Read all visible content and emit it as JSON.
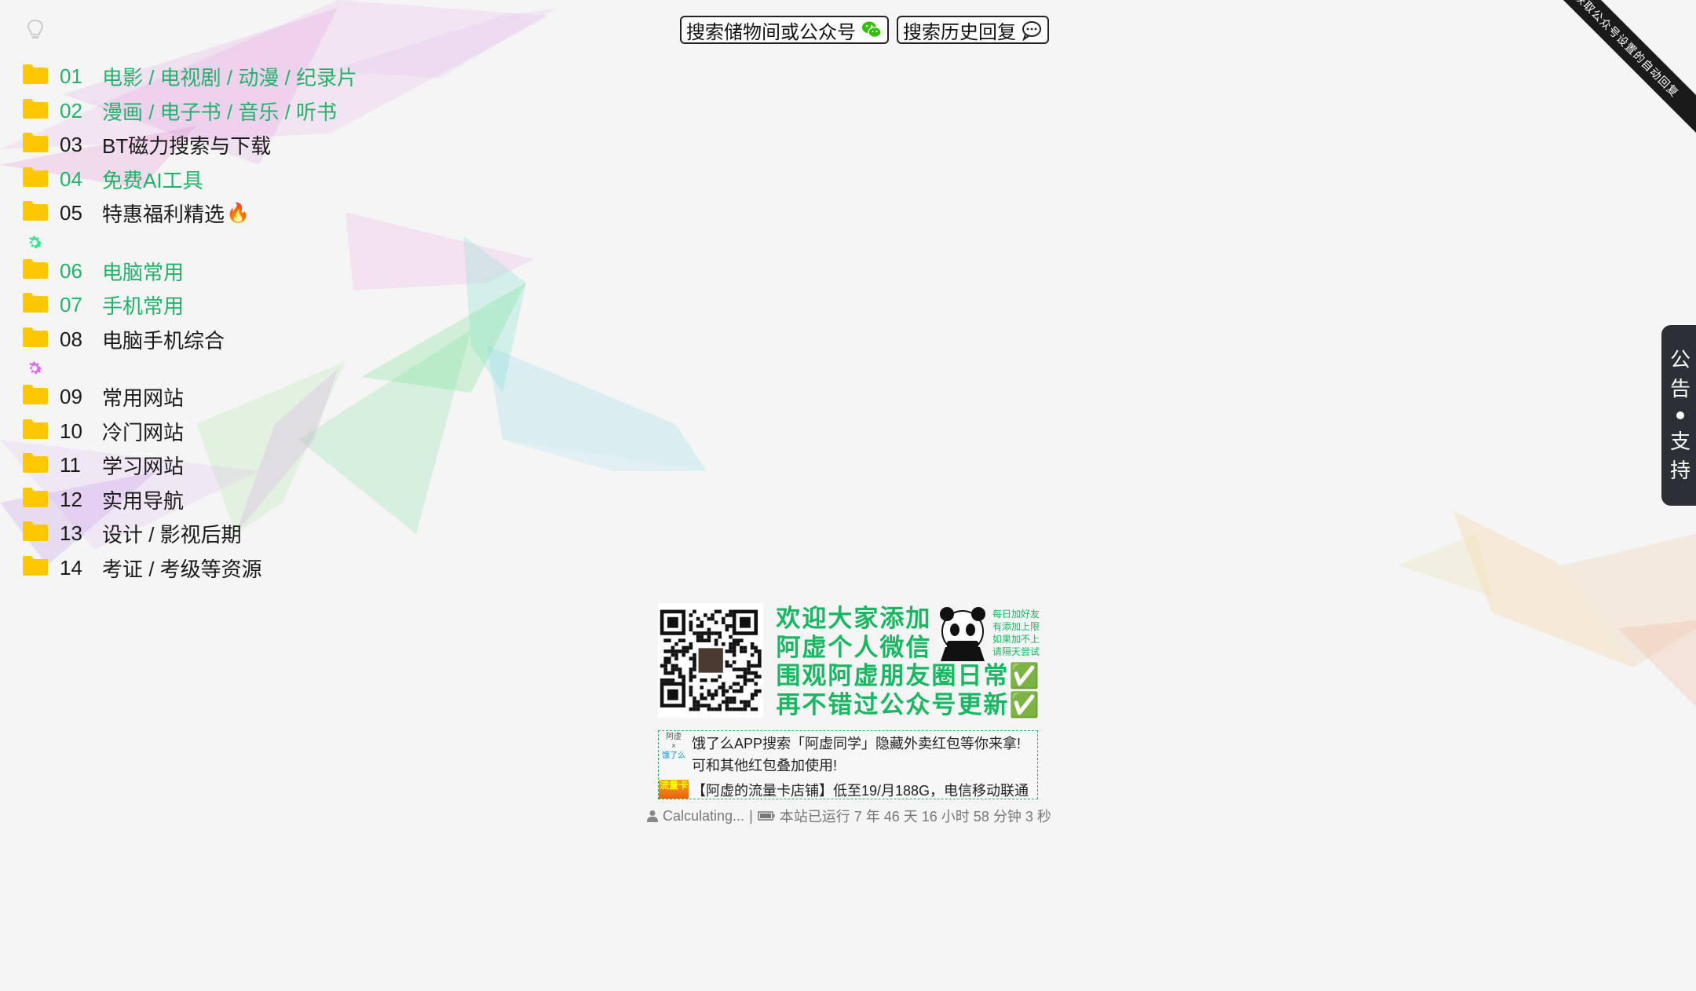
{
  "top_buttons": {
    "search_storage": "搜索储物间或公众号",
    "search_history": "搜索历史回复"
  },
  "corner_ribbon": "获取公众号设置的自动回复",
  "menu": {
    "items": [
      {
        "num": "01",
        "label": "电影 / 电视剧 / 动漫 / 纪录片",
        "color": "#23b26b"
      },
      {
        "num": "02",
        "label": "漫画 / 电子书 / 音乐 / 听书",
        "color": "#23b26b"
      },
      {
        "num": "03",
        "label": "BT磁力搜索与下载",
        "color": "#1a1a1a"
      },
      {
        "num": "04",
        "label": "免费AI工具",
        "color": "#23b26b"
      },
      {
        "num": "05",
        "label": "特惠福利精选",
        "color": "#1a1a1a",
        "icon": "fire-icon"
      },
      {
        "num": "06",
        "label": "电脑常用",
        "color": "#23b26b"
      },
      {
        "num": "07",
        "label": "手机常用",
        "color": "#23b26b"
      },
      {
        "num": "08",
        "label": "电脑手机综合",
        "color": "#1a1a1a"
      },
      {
        "num": "09",
        "label": "常用网站",
        "color": "#1a1a1a"
      },
      {
        "num": "10",
        "label": "冷门网站",
        "color": "#1a1a1a"
      },
      {
        "num": "11",
        "label": "学习网站",
        "color": "#1a1a1a"
      },
      {
        "num": "12",
        "label": "实用导航",
        "color": "#1a1a1a"
      },
      {
        "num": "13",
        "label": "设计 / 影视后期",
        "color": "#1a1a1a"
      },
      {
        "num": "14",
        "label": "考证 / 考级等资源",
        "color": "#1a1a1a"
      }
    ],
    "folder_color": "#ffc700",
    "gear_colors": [
      "#2ee58a",
      "#dd66ee"
    ]
  },
  "notice_tab": {
    "top": [
      "公",
      "告"
    ],
    "bottom": [
      "支",
      "持"
    ]
  },
  "banner": {
    "lines": [
      "欢迎大家添加",
      "阿虚个人微信",
      "围观阿虚朋友圈日常✅",
      "再不错过公众号更新✅"
    ],
    "panda_note": [
      "每日加好友",
      "有添加上限",
      "如果加不上",
      "请隔天尝试"
    ]
  },
  "ads": {
    "ad1_logo": [
      "阿虚",
      "×",
      "饿了么"
    ],
    "ad1_line1": "饿了么APP搜索「阿虚同学」隐藏外卖红包等你来拿!",
    "ad1_line2": "可和其他红包叠加使用!",
    "ad2_logo": "流量卡",
    "ad2_text": "【阿虚的流量卡店铺】低至19/月188G，电信移动联通"
  },
  "footer": {
    "visitors": "Calculating...",
    "separator": "|",
    "runtime": "本站已运行 7 年 46 天 16 小时 58 分钟 3 秒"
  }
}
